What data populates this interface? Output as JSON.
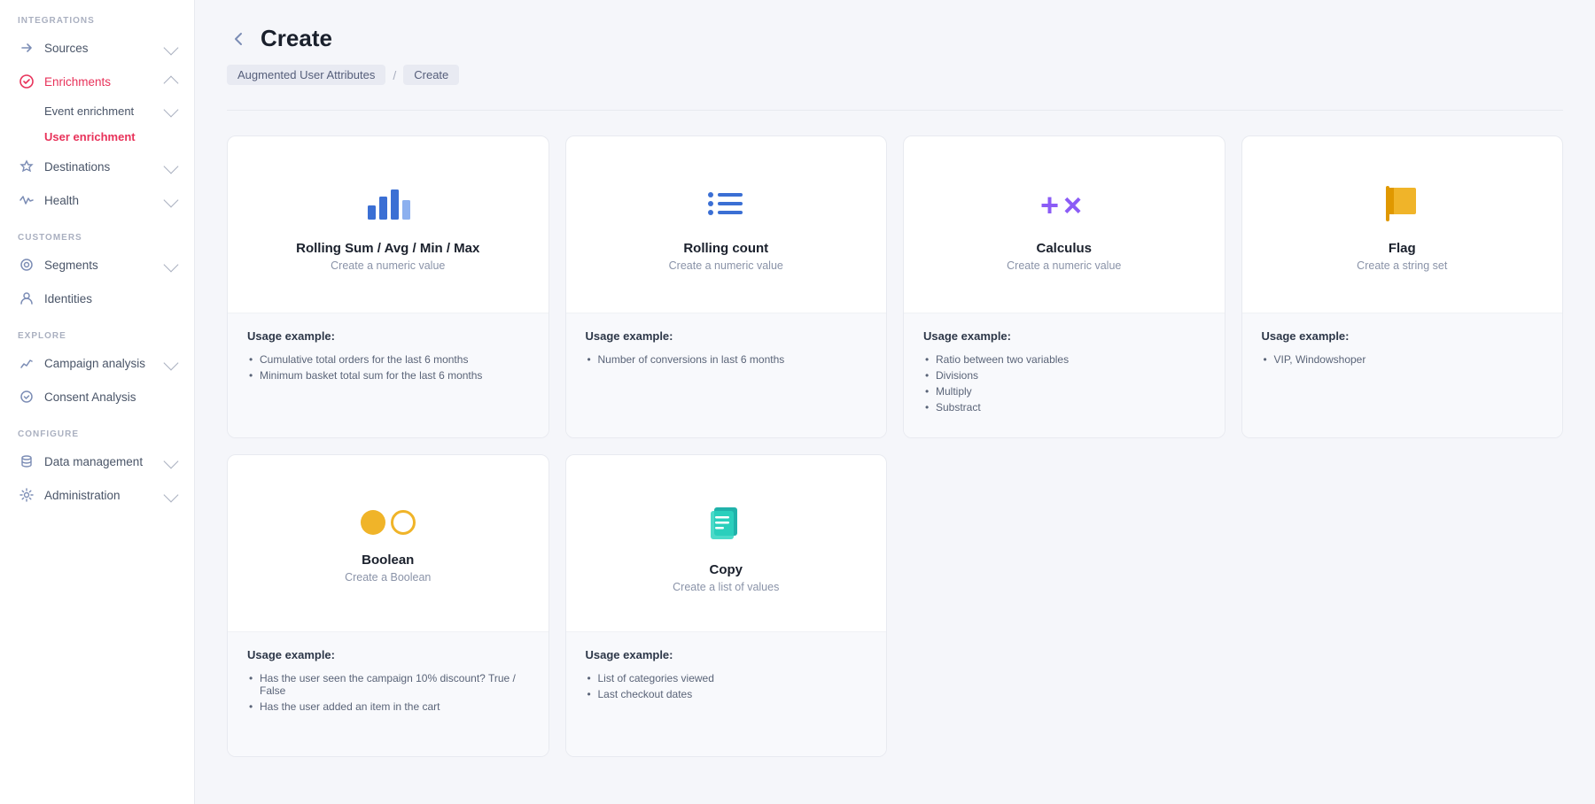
{
  "sidebar": {
    "sections": [
      {
        "label": "INTEGRATIONS",
        "items": [
          {
            "id": "sources",
            "label": "Sources",
            "icon": "arrow-right-icon",
            "hasChevron": true,
            "active": false
          },
          {
            "id": "enrichments",
            "label": "Enrichments",
            "icon": "enrichments-icon",
            "hasChevron": true,
            "active": true,
            "expanded": true,
            "children": [
              {
                "id": "event-enrichment",
                "label": "Event enrichment",
                "hasChevron": true,
                "active": false
              },
              {
                "id": "user-enrichment",
                "label": "User enrichment",
                "active": true
              }
            ]
          },
          {
            "id": "destinations",
            "label": "Destinations",
            "icon": "destinations-icon",
            "hasChevron": true,
            "active": false
          },
          {
            "id": "health",
            "label": "Health",
            "icon": "health-icon",
            "hasChevron": true,
            "active": false
          }
        ]
      },
      {
        "label": "CUSTOMERS",
        "items": [
          {
            "id": "segments",
            "label": "Segments",
            "icon": "segments-icon",
            "hasChevron": true,
            "active": false
          },
          {
            "id": "identities",
            "label": "Identities",
            "icon": "identities-icon",
            "active": false
          }
        ]
      },
      {
        "label": "EXPLORE",
        "items": [
          {
            "id": "campaign-analysis",
            "label": "Campaign analysis",
            "icon": "campaign-icon",
            "hasChevron": true,
            "active": false
          },
          {
            "id": "consent-analysis",
            "label": "Consent Analysis",
            "icon": "consent-icon",
            "active": false
          }
        ]
      },
      {
        "label": "CONFIGURE",
        "items": [
          {
            "id": "data-management",
            "label": "Data management",
            "icon": "data-icon",
            "hasChevron": true,
            "active": false
          },
          {
            "id": "administration",
            "label": "Administration",
            "icon": "admin-icon",
            "hasChevron": true,
            "active": false
          }
        ]
      }
    ]
  },
  "page": {
    "title": "Create",
    "breadcrumb": [
      {
        "label": "Augmented User Attributes"
      },
      {
        "label": "Create"
      }
    ]
  },
  "cards": [
    {
      "id": "rolling-sum",
      "title": "Rolling Sum / Avg / Min / Max",
      "subtitle": "Create a numeric value",
      "icon_type": "bar-chart",
      "usage_label": "Usage example:",
      "usage_items": [
        "Cumulative total orders for the last 6 months",
        "Minimum basket total sum for the last 6 months"
      ]
    },
    {
      "id": "rolling-count",
      "title": "Rolling count",
      "subtitle": "Create a numeric value",
      "icon_type": "list",
      "usage_label": "Usage example:",
      "usage_items": [
        "Number of conversions in last 6 months"
      ]
    },
    {
      "id": "calculus",
      "title": "Calculus",
      "subtitle": "Create a numeric value",
      "icon_type": "calc",
      "usage_label": "Usage example:",
      "usage_items": [
        "Ratio between two variables",
        "Divisions",
        "Multiply",
        "Substract"
      ]
    },
    {
      "id": "flag",
      "title": "Flag",
      "subtitle": "Create a string set",
      "icon_type": "flag",
      "usage_label": "Usage example:",
      "usage_items": [
        "VIP, Windowshoper"
      ]
    },
    {
      "id": "boolean",
      "title": "Boolean",
      "subtitle": "Create a Boolean",
      "icon_type": "boolean",
      "usage_label": "Usage example:",
      "usage_items": [
        "Has the user seen the campaign 10% discount? True / False",
        "Has the user added an item in the cart"
      ]
    },
    {
      "id": "copy",
      "title": "Copy",
      "subtitle": "Create a list of values",
      "icon_type": "copy",
      "usage_label": "Usage example:",
      "usage_items": [
        "List of categories viewed",
        "Last checkout dates"
      ]
    }
  ]
}
